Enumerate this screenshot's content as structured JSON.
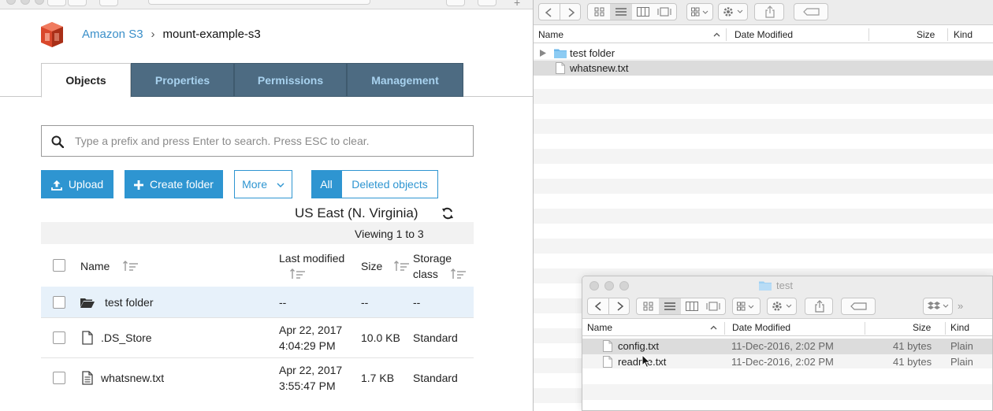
{
  "breadcrumb": {
    "service": "Amazon S3",
    "separator": "›",
    "bucket": "mount-example-s3"
  },
  "tabs": [
    {
      "label": "Objects",
      "active": true
    },
    {
      "label": "Properties",
      "active": false
    },
    {
      "label": "Permissions",
      "active": false
    },
    {
      "label": "Management",
      "active": false
    }
  ],
  "search": {
    "placeholder": "Type a prefix and press Enter to search. Press ESC to clear.",
    "value": ""
  },
  "buttons": {
    "upload": "Upload",
    "create_folder": "Create folder",
    "more": "More",
    "all": "All",
    "deleted_objects": "Deleted objects"
  },
  "region": "US East (N. Virginia)",
  "viewing": "Viewing 1 to 3",
  "table": {
    "headers": {
      "name": "Name",
      "last_modified": "Last modified",
      "size": "Size",
      "storage_class_1": "Storage",
      "storage_class_2": "class"
    },
    "rows": [
      {
        "name": "test folder",
        "icon": "folder-open-icon",
        "modified_1": "--",
        "modified_2": "",
        "size": "--",
        "storage": "--",
        "selected": true
      },
      {
        "name": ".DS_Store",
        "icon": "file-icon",
        "modified_1": "Apr 22, 2017",
        "modified_2": "4:04:29 PM",
        "size": "10.0 KB",
        "storage": "Standard",
        "selected": false
      },
      {
        "name": "whatsnew.txt",
        "icon": "text-file-icon",
        "modified_1": "Apr 22, 2017",
        "modified_2": "3:55:47 PM",
        "size": "1.7 KB",
        "storage": "Standard",
        "selected": false
      }
    ]
  },
  "finder": {
    "headers": {
      "name": "Name",
      "date_modified": "Date Modified",
      "size": "Size",
      "kind": "Kind"
    },
    "rows": [
      {
        "name": "test folder",
        "icon": "folder-icon",
        "selected": false
      },
      {
        "name": "whatsnew.txt",
        "icon": "file-icon",
        "selected": true
      }
    ]
  },
  "finder_inner": {
    "title": "test",
    "headers": {
      "name": "Name",
      "date_modified": "Date Modified",
      "size": "Size",
      "kind": "Kind"
    },
    "rows": [
      {
        "name": "config.txt",
        "date": "11-Dec-2016, 2:02 PM",
        "size": "41 bytes",
        "kind": "Plain",
        "selected": true
      },
      {
        "name": "readme.txt",
        "date": "11-Dec-2016, 2:02 PM",
        "size": "41 bytes",
        "kind": "Plain",
        "selected": false
      }
    ]
  },
  "colors": {
    "aws_blue": "#2e95d1",
    "tab_dark": "#4d6b82",
    "tab_text": "#a8d2ef",
    "row_selected": "#e7f1fa",
    "s3_red": "#d9472b"
  }
}
